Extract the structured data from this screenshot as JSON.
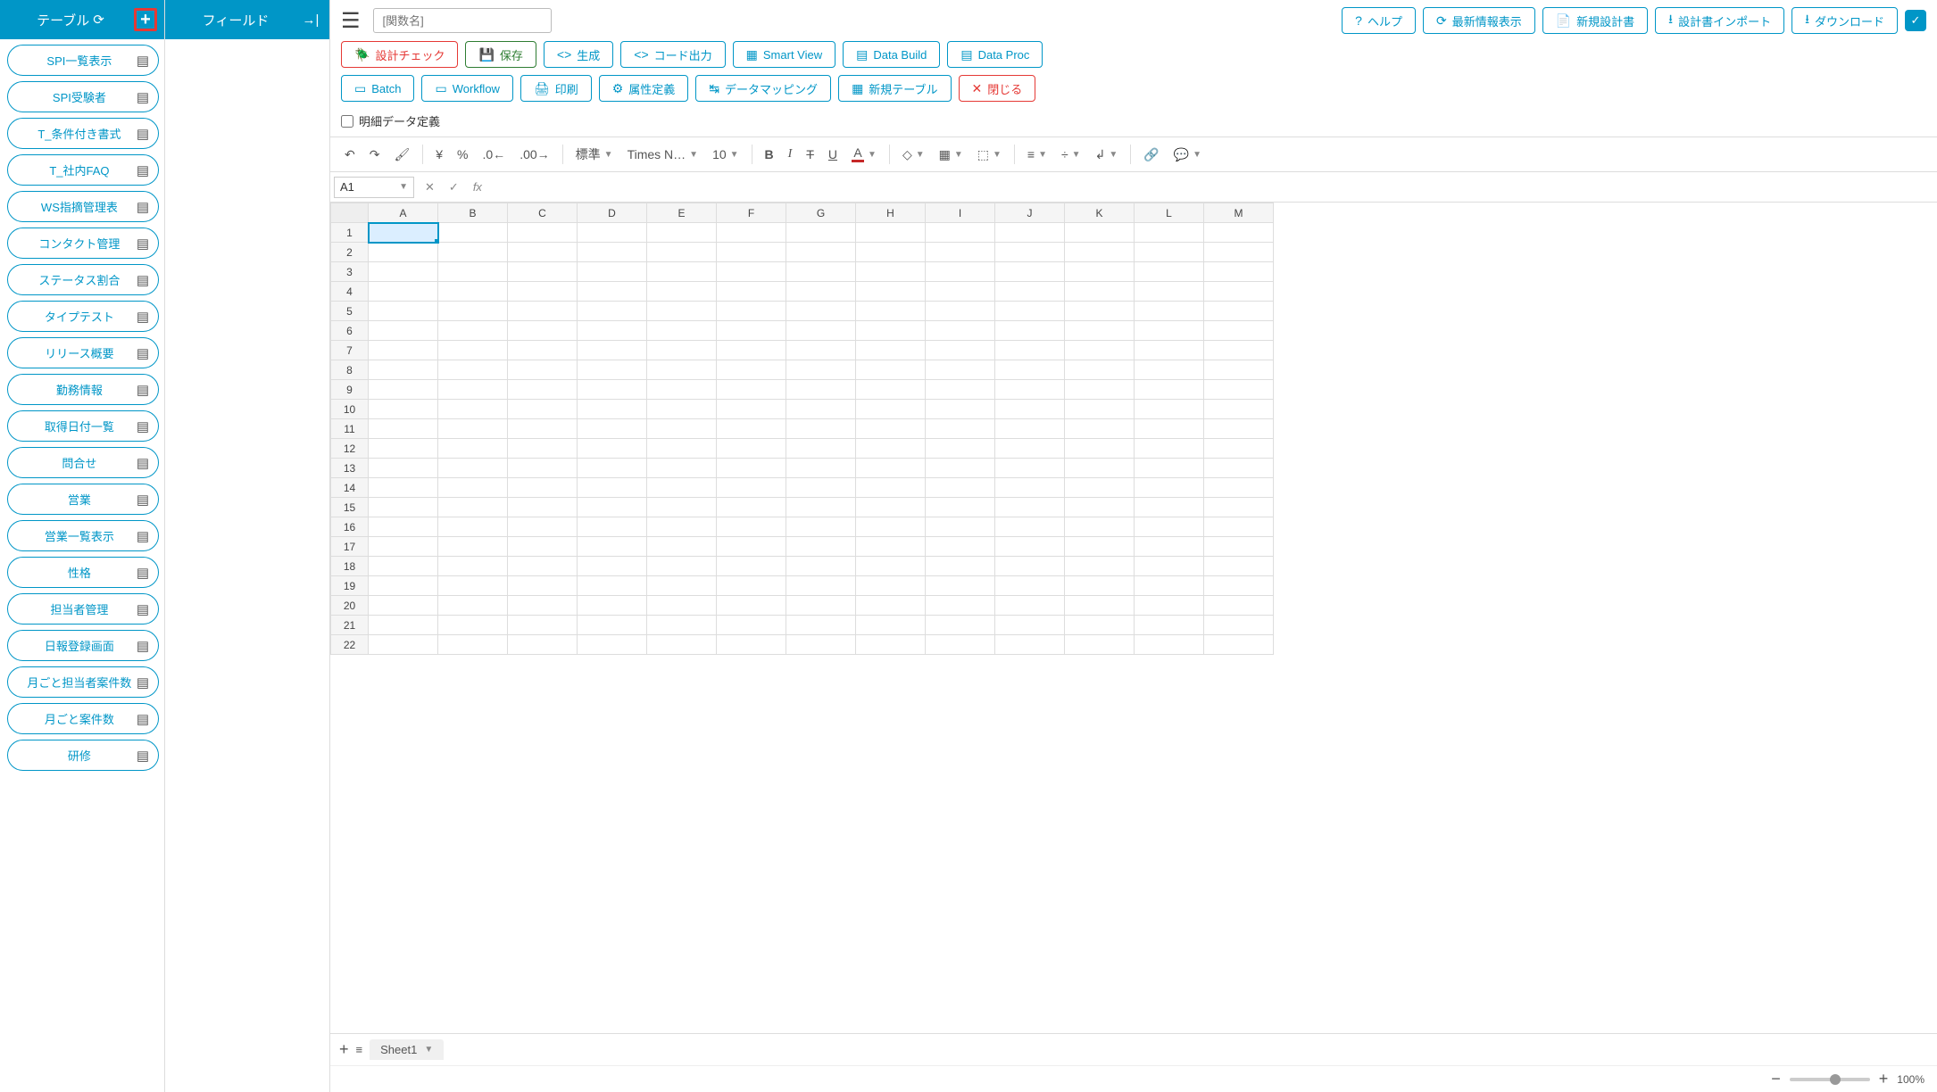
{
  "sidebar_left": {
    "title": "テーブル",
    "items": [
      "SPI一覧表示",
      "SPI受験者",
      "T_条件付き書式",
      "T_社内FAQ",
      "WS指摘管理表",
      "コンタクト管理",
      "ステータス割合",
      "タイプテスト",
      "リリース概要",
      "勤務情報",
      "取得日付一覧",
      "問合せ",
      "営業",
      "営業一覧表示",
      "性格",
      "担当者管理",
      "日報登録画面",
      "月ごと担当者案件数",
      "月ごと案件数",
      "研修"
    ]
  },
  "sidebar_mid": {
    "title": "フィールド"
  },
  "input_placeholder": "[関数名]",
  "buttons_row1": [
    "ヘルプ",
    "最新情報表示",
    "新規設計書",
    "設計書インポート",
    "ダウンロード"
  ],
  "buttons_row2": {
    "check": "設計チェック",
    "save": "保存",
    "gen": "生成",
    "code": "コード出力",
    "smart": "Smart View",
    "build": "Data Build",
    "proc": "Data Proc"
  },
  "buttons_row3": {
    "batch": "Batch",
    "workflow": "Workflow",
    "print": "印刷",
    "attr": "属性定義",
    "mapping": "データマッピング",
    "newtable": "新規テーブル",
    "close": "閉じる"
  },
  "checkbox_label": "明細データ定義",
  "format_bar": {
    "style": "標準",
    "font": "Times N…",
    "size": "10"
  },
  "cell_ref": "A1",
  "columns": [
    "A",
    "B",
    "C",
    "D",
    "E",
    "F",
    "G",
    "H",
    "I",
    "J",
    "K",
    "L",
    "M"
  ],
  "rows": 22,
  "sheet_tab": "Sheet1",
  "zoom": "100%"
}
